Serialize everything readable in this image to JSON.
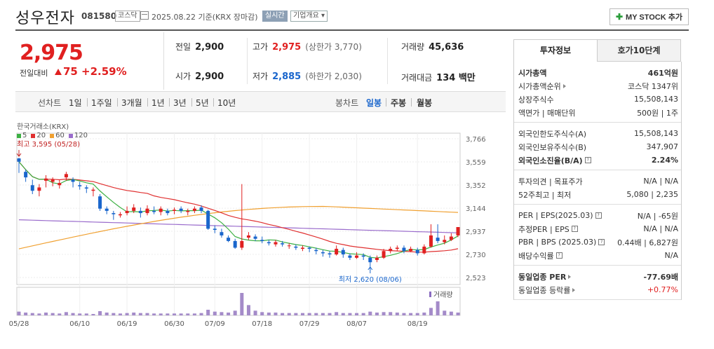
{
  "header": {
    "name": "성우전자",
    "code": "081580",
    "market": "코스닥",
    "date": "2025.08.22 기준(KRX 장마감)",
    "realtime": "실시간",
    "company_info": "기업개요 ▾",
    "mystock": "MY STOCK 추가"
  },
  "price": {
    "current": "2,975",
    "change_label": "전일대비",
    "change_amount": "75",
    "change_pct": "+2.59%"
  },
  "summary": {
    "prev_close": {
      "label": "전일",
      "value": "2,900"
    },
    "high": {
      "label": "고가",
      "value": "2,975",
      "sub": "(상한가 3,770)"
    },
    "volume": {
      "label": "거래량",
      "value": "45,636"
    },
    "open": {
      "label": "시가",
      "value": "2,900"
    },
    "low": {
      "label": "저가",
      "value": "2,885",
      "sub": "(하한가 2,030)"
    },
    "amount": {
      "label": "거래대금",
      "value": "134 백만"
    }
  },
  "toolbar": {
    "line_chart": "선차트",
    "periods": [
      "1일",
      "1주일",
      "3개월",
      "1년",
      "3년",
      "5년",
      "10년"
    ],
    "candle_chart": "봉차트",
    "candle_periods": [
      "일봉",
      "주봉",
      "월봉"
    ]
  },
  "colors": {
    "up": "#e02020",
    "down": "#1a66cc",
    "ma5": "#3cb043",
    "ma20": "#e03030",
    "ma60": "#f0a030",
    "ma120": "#9a6ccc"
  },
  "chart_data": {
    "type": "candlestick",
    "source_label": "한국거래소(KRX)",
    "legend": [
      {
        "name": "5",
        "color": "#3cb043"
      },
      {
        "name": "20",
        "color": "#e03030"
      },
      {
        "name": "60",
        "color": "#f0a030"
      },
      {
        "name": "120",
        "color": "#9a6ccc"
      }
    ],
    "y_ticks": [
      3766,
      3559,
      3352,
      3144,
      2937,
      2730,
      2523
    ],
    "ylim": [
      2523,
      3766
    ],
    "x_ticks": [
      "05/28",
      "06/10",
      "06/19",
      "06/30",
      "07/09",
      "07/18",
      "07/29",
      "08/07",
      "08/19"
    ],
    "max_label": "최고 3,595 (05/28)",
    "min_label": "최저 2,620 (08/06)",
    "volume_label": "거래량",
    "candles": [
      [
        3590,
        3560,
        3595,
        3460
      ],
      [
        3470,
        3420,
        3490,
        3380
      ],
      [
        3350,
        3300,
        3400,
        3270
      ],
      [
        3300,
        3330,
        3360,
        3250
      ],
      [
        3390,
        3410,
        3440,
        3330
      ],
      [
        3380,
        3400,
        3420,
        3340
      ],
      [
        3350,
        3370,
        3400,
        3320
      ],
      [
        3420,
        3450,
        3470,
        3390
      ],
      [
        3400,
        3380,
        3420,
        3330
      ],
      [
        3350,
        3340,
        3380,
        3310
      ],
      [
        3330,
        3320,
        3350,
        3280
      ],
      [
        3300,
        3310,
        3330,
        3250
      ],
      [
        3250,
        3140,
        3270,
        3120
      ],
      [
        3140,
        3120,
        3160,
        3090
      ],
      [
        3100,
        3090,
        3120,
        3040
      ],
      [
        3080,
        3090,
        3110,
        3060
      ],
      [
        3100,
        3120,
        3160,
        3080
      ],
      [
        3120,
        3150,
        3180,
        3100
      ],
      [
        3120,
        3100,
        3150,
        3060
      ],
      [
        3100,
        3140,
        3170,
        3080
      ],
      [
        3120,
        3110,
        3160,
        3090
      ],
      [
        3110,
        3140,
        3160,
        3080
      ],
      [
        3120,
        3100,
        3140,
        3080
      ],
      [
        3120,
        3130,
        3150,
        3090
      ],
      [
        3140,
        3120,
        3160,
        3100
      ],
      [
        3110,
        3120,
        3140,
        3080
      ],
      [
        3120,
        3140,
        3160,
        3100
      ],
      [
        3150,
        3120,
        3170,
        3100
      ],
      [
        3120,
        2960,
        3130,
        2950
      ],
      [
        2960,
        2950,
        2990,
        2920
      ],
      [
        2930,
        2900,
        2960,
        2880
      ],
      [
        2880,
        2850,
        2900,
        2840
      ],
      [
        2850,
        2790,
        2870,
        2780
      ],
      [
        2790,
        2850,
        3360,
        2770
      ],
      [
        2880,
        2900,
        2930,
        2860
      ],
      [
        2890,
        2870,
        2910,
        2850
      ],
      [
        2860,
        2850,
        2890,
        2830
      ],
      [
        2840,
        2830,
        2860,
        2810
      ],
      [
        2820,
        2840,
        2860,
        2800
      ],
      [
        2830,
        2820,
        2850,
        2800
      ],
      [
        2810,
        2810,
        2830,
        2780
      ],
      [
        2800,
        2790,
        2820,
        2770
      ],
      [
        2780,
        2790,
        2810,
        2760
      ],
      [
        2790,
        2780,
        2800,
        2750
      ],
      [
        2770,
        2760,
        2790,
        2730
      ],
      [
        2750,
        2740,
        2770,
        2710
      ],
      [
        2740,
        2730,
        2760,
        2700
      ],
      [
        2730,
        2780,
        2810,
        2720
      ],
      [
        2770,
        2730,
        2790,
        2700
      ],
      [
        2720,
        2700,
        2740,
        2680
      ],
      [
        2700,
        2720,
        2750,
        2690
      ],
      [
        2720,
        2710,
        2740,
        2680
      ],
      [
        2700,
        2660,
        2720,
        2620
      ],
      [
        2680,
        2700,
        2720,
        2660
      ],
      [
        2700,
        2760,
        2780,
        2690
      ],
      [
        2760,
        2780,
        2800,
        2740
      ],
      [
        2780,
        2790,
        2810,
        2760
      ],
      [
        2790,
        2760,
        2810,
        2740
      ],
      [
        2760,
        2780,
        2800,
        2750
      ],
      [
        2770,
        2740,
        2790,
        2720
      ],
      [
        2740,
        2800,
        2820,
        2730
      ],
      [
        2800,
        2900,
        3000,
        2790
      ],
      [
        2880,
        2850,
        3000,
        2830
      ],
      [
        2840,
        2860,
        2900,
        2820
      ],
      [
        2860,
        2890,
        2920,
        2850
      ],
      [
        2900,
        2975,
        2975,
        2885
      ]
    ],
    "volumes": [
      8,
      6,
      5,
      4,
      6,
      5,
      4,
      7,
      5,
      4,
      4,
      3,
      9,
      6,
      5,
      4,
      5,
      6,
      5,
      5,
      4,
      4,
      4,
      4,
      4,
      4,
      4,
      5,
      12,
      8,
      7,
      6,
      10,
      48,
      22,
      10,
      7,
      6,
      6,
      5,
      5,
      5,
      5,
      5,
      5,
      5,
      5,
      7,
      5,
      5,
      5,
      5,
      8,
      6,
      7,
      7,
      6,
      5,
      5,
      5,
      6,
      16,
      30,
      10,
      8,
      6
    ]
  },
  "panel": {
    "tabs": [
      "투자정보",
      "호가10단계"
    ],
    "sec1": [
      {
        "k": "시가총액",
        "v": "461억원",
        "bold": true
      },
      {
        "k": "시가총액순위",
        "v": "코스닥 1347위",
        "arrow": true
      },
      {
        "k": "상장주식수",
        "v": "15,508,143"
      },
      {
        "k": "액면가 | 매매단위",
        "v": "500원 | 1주"
      }
    ],
    "sec2": [
      {
        "k": "외국인한도주식수(A)",
        "v": "15,508,143"
      },
      {
        "k": "외국인보유주식수(B)",
        "v": "347,907"
      },
      {
        "k": "외국인소진율(B/A)",
        "v": "2.24%",
        "bold": true,
        "info": true
      }
    ],
    "sec3": [
      {
        "k": "투자의견 | 목표주가",
        "v": "N/A | N/A"
      },
      {
        "k": "52주최고 | 최저",
        "v": "5,080 | 2,235"
      }
    ],
    "sec4": [
      {
        "k": "PER | EPS(2025.03)",
        "v": "N/A | -65원",
        "info": true
      },
      {
        "k": "추정PER | EPS",
        "v": "N/A | N/A",
        "info": true
      },
      {
        "k": "PBR | BPS (2025.03)",
        "v": "0.44배 | 6,827원",
        "info": true
      },
      {
        "k": "배당수익률",
        "v": "N/A",
        "info": true
      }
    ],
    "sec5": [
      {
        "k": "동일업종 PER",
        "v": "-77.69배",
        "bold": true,
        "arrow": true
      },
      {
        "k": "동일업종 등락률",
        "v": "+0.77%",
        "up": true,
        "arrow": true
      }
    ]
  }
}
